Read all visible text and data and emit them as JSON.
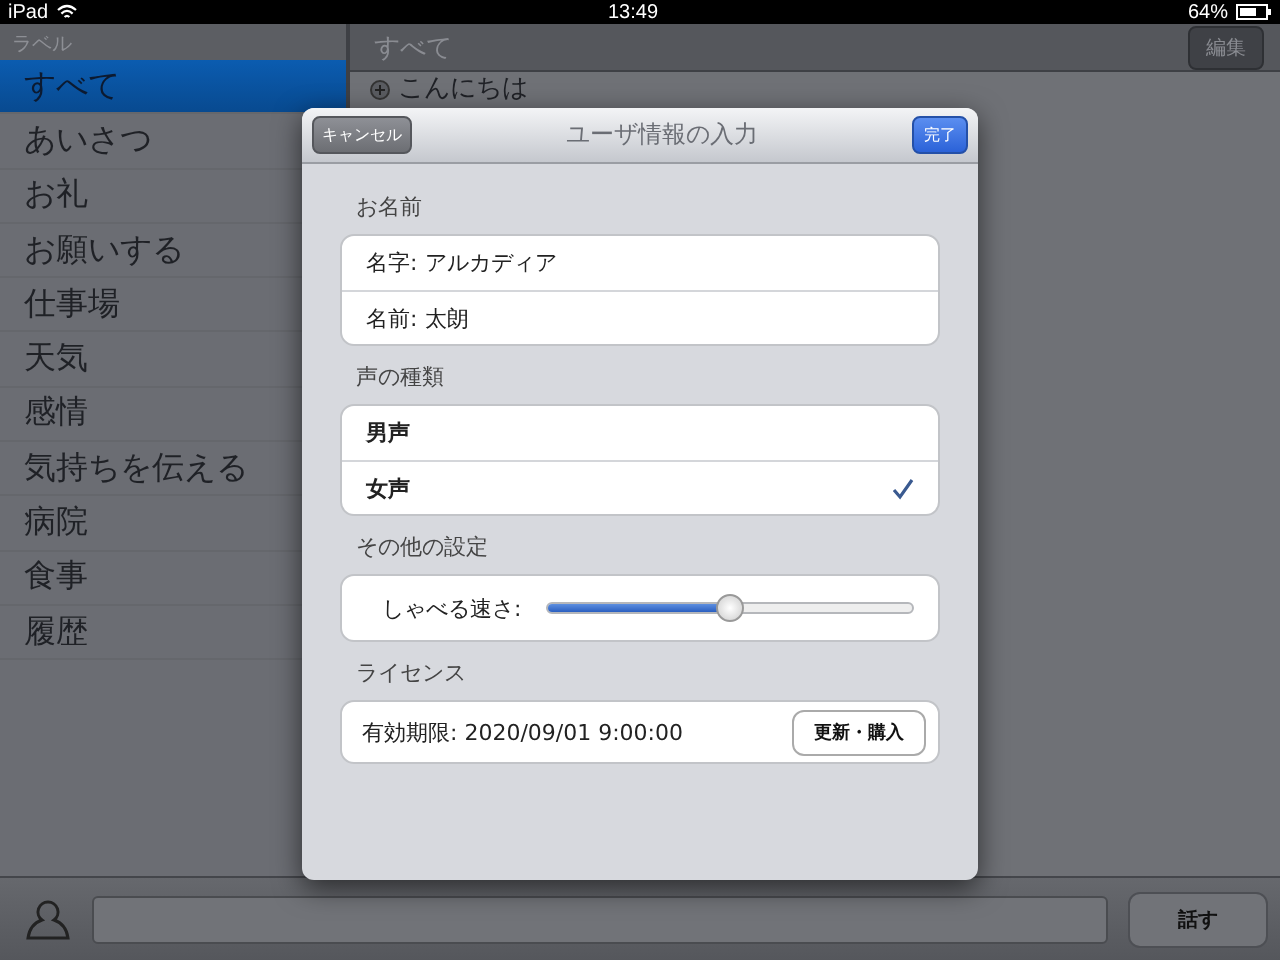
{
  "status_bar": {
    "device": "iPad",
    "time": "13:49",
    "battery": "64%"
  },
  "sidebar": {
    "header": "ラベル",
    "items": [
      {
        "label": "すべて",
        "selected": true
      },
      {
        "label": "あいさつ",
        "selected": false
      },
      {
        "label": "お礼",
        "selected": false
      },
      {
        "label": "お願いする",
        "selected": false
      },
      {
        "label": "仕事場",
        "selected": false
      },
      {
        "label": "天気",
        "selected": false
      },
      {
        "label": "感情",
        "selected": false
      },
      {
        "label": "気持ちを伝える",
        "selected": false
      },
      {
        "label": "病院",
        "selected": false
      },
      {
        "label": "食事",
        "selected": false
      },
      {
        "label": "履歴",
        "selected": false
      }
    ]
  },
  "main": {
    "title": "すべて",
    "edit_button": "編集",
    "rows": [
      "こんにちは"
    ]
  },
  "bottom_bar": {
    "speak_button": "話す"
  },
  "dialog": {
    "title": "ユーザ情報の入力",
    "cancel_button": "キャンセル",
    "done_button": "完了",
    "sections": [
      {
        "header": "お名前",
        "rows": [
          {
            "kind": "text",
            "label": "名字:",
            "value": "アルカディア"
          },
          {
            "kind": "text",
            "label": "名前:",
            "value": "太朗"
          }
        ]
      },
      {
        "header": "声の種類",
        "rows": [
          {
            "kind": "choice",
            "label": "男声",
            "selected": false
          },
          {
            "kind": "choice",
            "label": "女声",
            "selected": true
          }
        ]
      },
      {
        "header": "その他の設定",
        "rows": [
          {
            "kind": "slider",
            "label": "しゃべる速さ:",
            "level": 0.5
          }
        ]
      },
      {
        "header": "ライセンス",
        "rows": [
          {
            "kind": "button_row",
            "label": "有効期限: 2020/09/01 9:00:00",
            "button": "更新・購入"
          }
        ]
      }
    ]
  }
}
